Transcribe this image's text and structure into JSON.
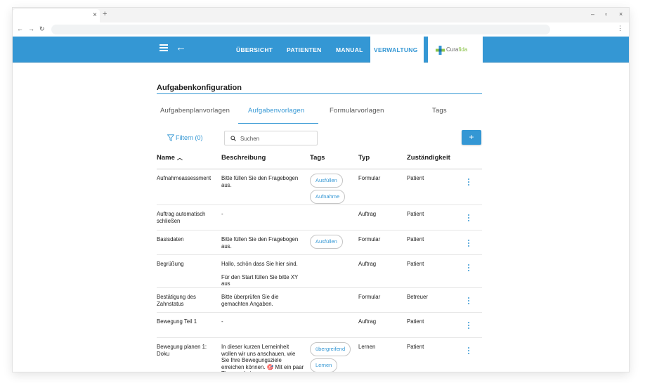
{
  "browser": {
    "tab_close": "×",
    "new_tab": "+",
    "win_minimize": "–",
    "win_restore": "▫",
    "win_close": "×",
    "nav_back": "←",
    "nav_forward": "→",
    "nav_reload": "↻",
    "menu": "⋮"
  },
  "appbar": {
    "back_icon": "arrow-left-icon",
    "nav": [
      "ÜBERSICHT",
      "PATIENTEN",
      "MANUAL",
      "VERWALTUNG"
    ],
    "active_nav": "VERWALTUNG",
    "logo_text_a": "Cura",
    "logo_text_b": "fida",
    "brand_color": "#3497d4"
  },
  "page": {
    "title": "Aufgabenkonfiguration",
    "subtabs": [
      "Aufgabenplanvorlagen",
      "Aufgabenvorlagen",
      "Formularvorlagen",
      "Tags"
    ],
    "active_subtab": "Aufgabenvorlagen"
  },
  "toolbar": {
    "filter_label": "Filtern (0)",
    "search_placeholder": "Suchen",
    "add_label": "+"
  },
  "table": {
    "headers": {
      "name": "Name",
      "name_sort": "︿",
      "desc": "Beschreibung",
      "tags": "Tags",
      "typ": "Typ",
      "zust": "Zuständigkeit"
    },
    "rows": [
      {
        "name": "Aufnahmeassessment",
        "desc": [
          "Bitte füllen Sie den Fragebogen aus."
        ],
        "tags": [
          "Ausfüllen",
          "Aufnahme"
        ],
        "typ": "Formular",
        "zust": "Patient"
      },
      {
        "name": "Auftrag automatisch schließen",
        "desc": [
          "-"
        ],
        "tags": [],
        "typ": "Auftrag",
        "zust": "Patient"
      },
      {
        "name": "Basisdaten",
        "desc": [
          "Bitte füllen Sie den Fragebogen aus."
        ],
        "tags": [
          "Ausfüllen"
        ],
        "typ": "Formular",
        "zust": "Patient"
      },
      {
        "name": "Begrüßung",
        "desc": [
          "Hallo, schön dass Sie hier sind.",
          "Für den Start füllen Sie bitte XY aus"
        ],
        "tags": [],
        "typ": "Auftrag",
        "zust": "Patient"
      },
      {
        "name": "Bestätigung des Zahnstatus",
        "desc": [
          "Bitte überprüfen Sie die gemachten Angaben."
        ],
        "tags": [],
        "typ": "Formular",
        "zust": "Betreuer"
      },
      {
        "name": "Bewegung Teil 1",
        "desc": [
          "-"
        ],
        "tags": [],
        "typ": "Auftrag",
        "zust": "Patient"
      },
      {
        "name": "Bewegung planen 1: Doku",
        "desc": [
          "In dieser kurzen Lerneinheit wollen wir uns anschauen, wie Sie Ihre Bewegungsziele erreichen können. 🎯 Mit ein paar Tipps und einer"
        ],
        "tags": [
          "übergreifend",
          "Lernen",
          ""
        ],
        "typ": "Lernen",
        "zust": "Patient"
      }
    ]
  }
}
